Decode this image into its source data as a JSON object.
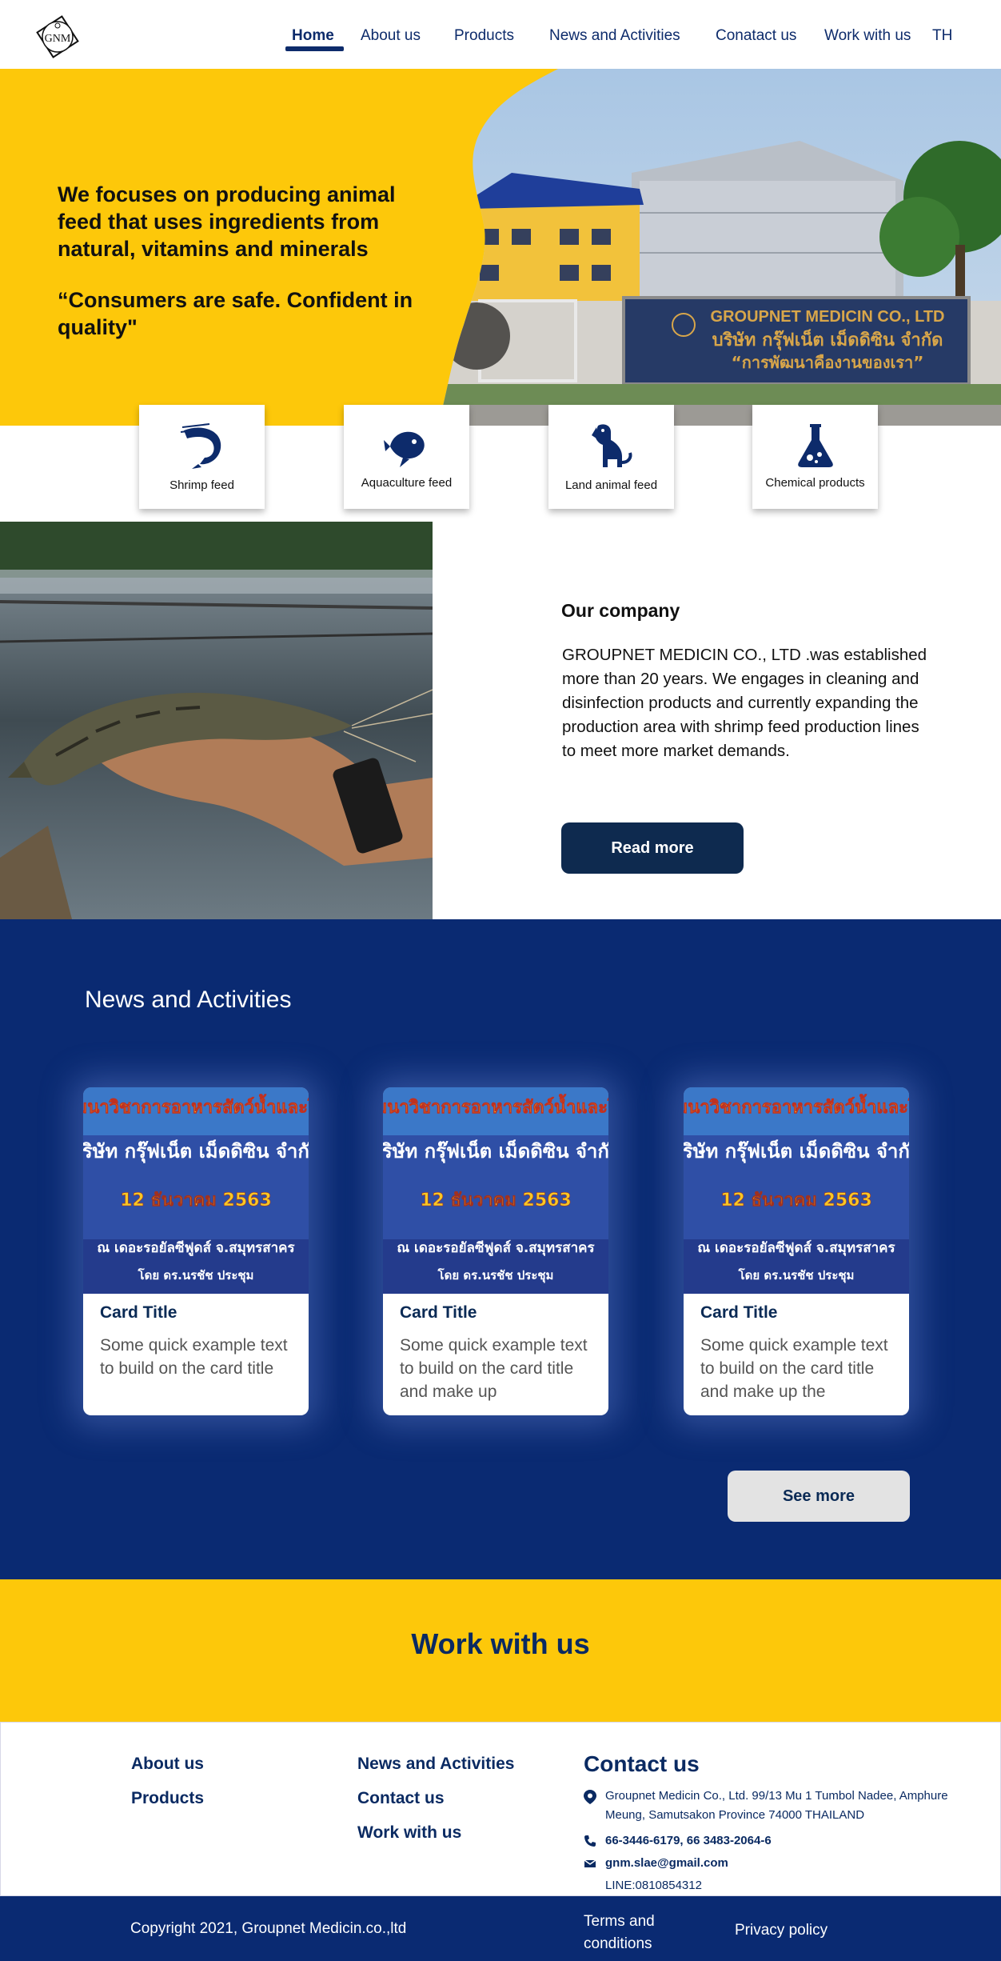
{
  "header": {
    "logo_text": "GNM",
    "nav": [
      {
        "label": "Home",
        "active": true
      },
      {
        "label": "About us"
      },
      {
        "label": "Products"
      },
      {
        "label": "News and Activities"
      },
      {
        "label": "Conatact us"
      },
      {
        "label": "Work with us"
      },
      {
        "label": "TH"
      }
    ]
  },
  "hero": {
    "headline": "We focuses on producing animal feed that uses ingredients from natural,  vitamins and minerals",
    "quote": "“Consumers are safe. Confident in quality\"",
    "sign_line1": "GROUPNET MEDICIN CO., LTD",
    "sign_line2": "บริษัท กรุ๊ฟเน็ต เม็ดดิซิน จำกัด",
    "sign_line3": "“การพัฒนาคืองานของเรา”"
  },
  "categories": [
    {
      "label": "Shrimp feed",
      "icon": "shrimp-icon"
    },
    {
      "label": "Aquaculture feed",
      "icon": "fish-icon"
    },
    {
      "label": "Land animal feed",
      "icon": "dog-icon"
    },
    {
      "label": "Chemical products",
      "icon": "flask-icon"
    }
  ],
  "company": {
    "title": "Our company",
    "text": "GROUPNET MEDICIN CO., LTD .was established more than 20 years. We engages in cleaning and disinfection products and currently expanding the production area with shrimp feed production lines to meet more market demands.",
    "button": "Read more"
  },
  "news": {
    "title": "News and Activities",
    "banner_line1": "สัมมนาวิชาการอาหารสัตว์น้ำและโรค",
    "banner_line2": "บริษัท กรุ๊ฟเน็ต เม็ดดิซิน จำกัด",
    "banner_line3": "12 ธันวาคม 2563",
    "banner_line4": "ณ เดอะรอยัลซีฟูดส์ จ.สมุทรสาคร",
    "banner_line5": "โดย ดร.นรชัช ประชุม",
    "cards": [
      {
        "title": "Card Title",
        "text": "Some quick example text to build on the card title"
      },
      {
        "title": "Card Title",
        "text": "Some quick example text to build on the card title and make up"
      },
      {
        "title": "Card Title",
        "text": "Some quick example text to build on the card title and make up the"
      }
    ],
    "see_more": "See more"
  },
  "work": {
    "title": "Work with us"
  },
  "footer": {
    "col1": [
      "About us",
      "Products"
    ],
    "col2": [
      "News and Activities",
      "Contact us",
      "Work with us"
    ],
    "contact_title": "Contact us",
    "address_line1": "Groupnet Medicin Co., Ltd. 99/13 Mu 1 Tumbol Nadee,  Amphure",
    "address_line2": "Meung, Samutsakon Province 74000 THAILAND",
    "phone": "66-3446-6179, 66 3483-2064-6",
    "email": "gnm.slae@gmail.com",
    "line": "LINE:0810854312",
    "copyright": "Copyright 2021, Groupnet Medicin.co.,ltd",
    "terms": "Terms and conditions",
    "privacy": "Privacy policy"
  },
  "colors": {
    "brand_yellow": "#fdc80a",
    "brand_navy": "#0a2a72",
    "button_dark": "#0e2a4f"
  }
}
